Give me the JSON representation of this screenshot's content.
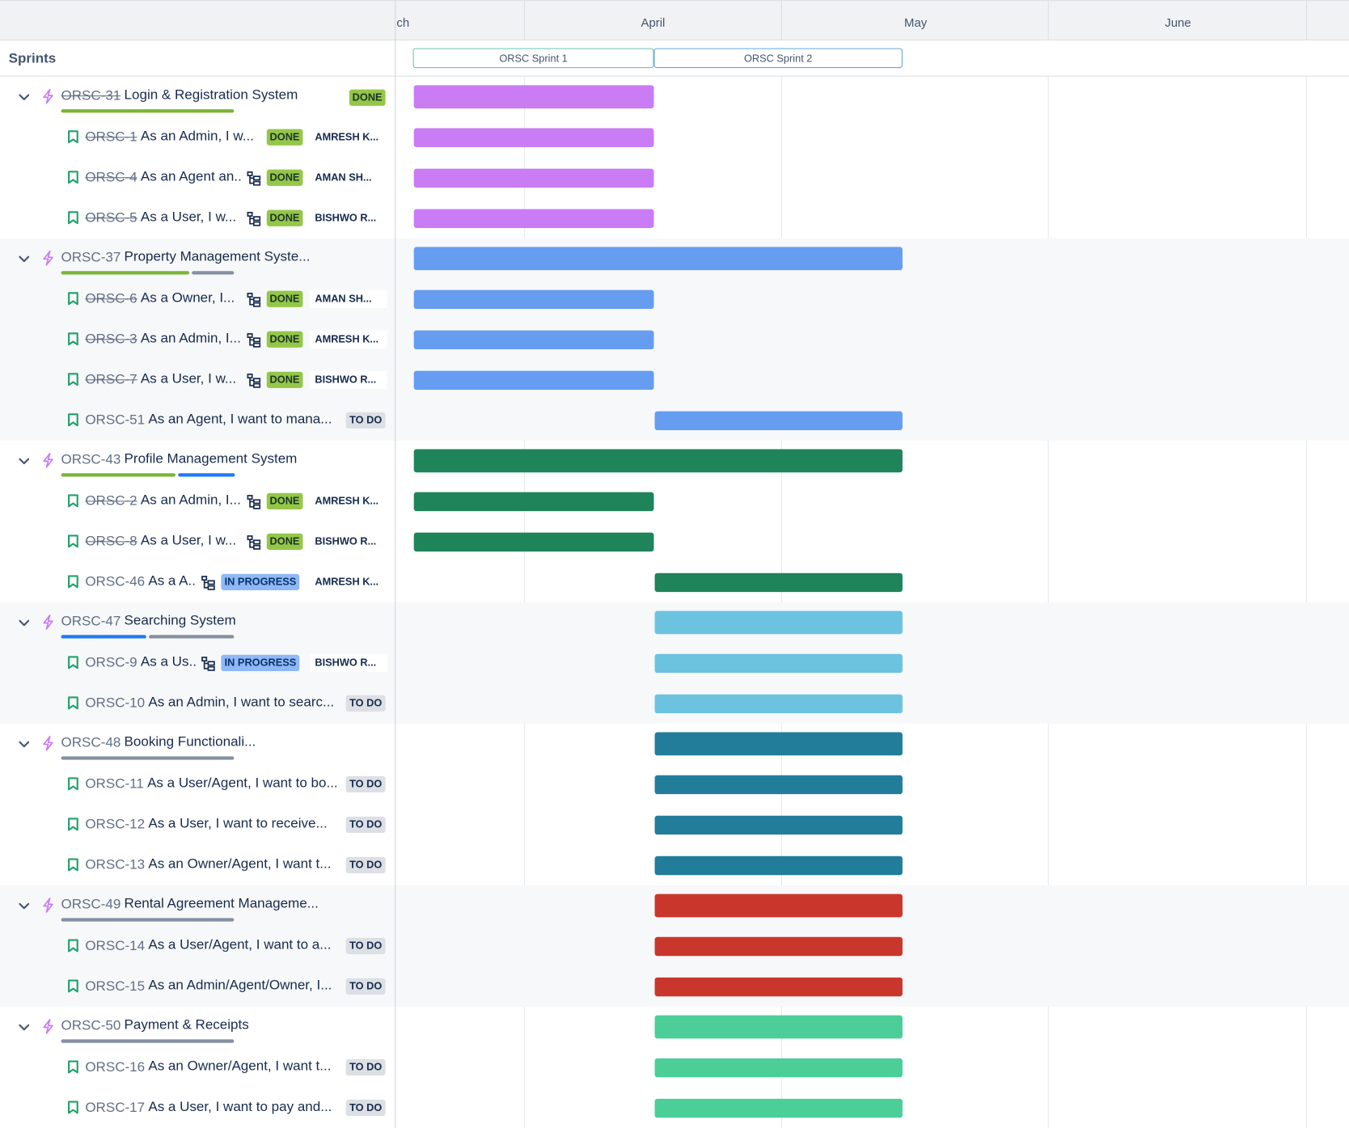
{
  "header": {
    "months": [
      "ch",
      "April",
      "May",
      "June"
    ],
    "sprints_label": "Sprints",
    "sprints": [
      "ORSC Sprint 1",
      "ORSC Sprint 2"
    ]
  },
  "colors": {
    "purple": "#c97cf4",
    "blue": "#669df1",
    "green": "#1f845a",
    "lightblue": "#6cc3e0",
    "teal": "#227d9b",
    "red": "#c9372c",
    "mint": "#4bce97",
    "done_green": "#94c748",
    "todo_grey": "#dcdfe4",
    "progress_blue": "#8fb8f6"
  },
  "epics": [
    {
      "key": "ORSC-31",
      "title": "Login & Registration System",
      "status": "DONE",
      "done": true,
      "color": "purple",
      "children": [
        {
          "key": "ORSC-1",
          "title": "As an Admin, I w...",
          "status": "DONE",
          "assignee": "AMRESH K...",
          "done": true,
          "hier": false
        },
        {
          "key": "ORSC-4",
          "title": "As an Agent an...",
          "status": "DONE",
          "assignee": "AMAN SH...",
          "done": true,
          "hier": true
        },
        {
          "key": "ORSC-5",
          "title": "As a User, I w...",
          "status": "DONE",
          "assignee": "BISHWO R...",
          "done": true,
          "hier": true
        }
      ]
    },
    {
      "key": "ORSC-37",
      "title": "Property Management Syste...",
      "status": "",
      "done": false,
      "color": "blue",
      "children": [
        {
          "key": "ORSC-6",
          "title": "As a Owner, I...",
          "status": "DONE",
          "assignee": "AMAN SH...",
          "done": true,
          "hier": true
        },
        {
          "key": "ORSC-3",
          "title": "As an Admin, I...",
          "status": "DONE",
          "assignee": "AMRESH K...",
          "done": true,
          "hier": true
        },
        {
          "key": "ORSC-7",
          "title": "As a User, I w...",
          "status": "DONE",
          "assignee": "BISHWO R...",
          "done": true,
          "hier": true
        },
        {
          "key": "ORSC-51",
          "title": "As an Agent, I want to mana...",
          "status": "TO DO",
          "assignee": "",
          "done": false,
          "hier": false
        }
      ]
    },
    {
      "key": "ORSC-43",
      "title": "Profile Management System",
      "status": "",
      "done": false,
      "color": "green",
      "children": [
        {
          "key": "ORSC-2",
          "title": "As an Admin, I...",
          "status": "DONE",
          "assignee": "AMRESH K...",
          "done": true,
          "hier": true
        },
        {
          "key": "ORSC-8",
          "title": "As a User, I w...",
          "status": "DONE",
          "assignee": "BISHWO R...",
          "done": true,
          "hier": true
        },
        {
          "key": "ORSC-46",
          "title": "As a A...",
          "status": "IN PROGRESS",
          "assignee": "AMRESH K...",
          "done": false,
          "hier": true
        }
      ]
    },
    {
      "key": "ORSC-47",
      "title": "Searching System",
      "status": "",
      "done": false,
      "color": "lightblue",
      "children": [
        {
          "key": "ORSC-9",
          "title": "As a Us...",
          "status": "IN PROGRESS",
          "assignee": "BISHWO R...",
          "done": false,
          "hier": true
        },
        {
          "key": "ORSC-10",
          "title": "As an Admin, I want to searc...",
          "status": "TO DO",
          "assignee": "",
          "done": false,
          "hier": false
        }
      ]
    },
    {
      "key": "ORSC-48",
      "title": "Booking Functionali...",
      "status": "",
      "done": false,
      "color": "teal",
      "children": [
        {
          "key": "ORSC-11",
          "title": "As a User/Agent, I want to bo...",
          "status": "TO DO",
          "assignee": "",
          "done": false,
          "hier": false
        },
        {
          "key": "ORSC-12",
          "title": "As a User, I want to receive...",
          "status": "TO DO",
          "assignee": "",
          "done": false,
          "hier": false
        },
        {
          "key": "ORSC-13",
          "title": "As an Owner/Agent, I want t...",
          "status": "TO DO",
          "assignee": "",
          "done": false,
          "hier": false
        }
      ]
    },
    {
      "key": "ORSC-49",
      "title": "Rental Agreement Manageme...",
      "status": "",
      "done": false,
      "color": "red",
      "children": [
        {
          "key": "ORSC-14",
          "title": "As a User/Agent, I want to a...",
          "status": "TO DO",
          "assignee": "",
          "done": false,
          "hier": false
        },
        {
          "key": "ORSC-15",
          "title": "As an Admin/Agent/Owner, I...",
          "status": "TO DO",
          "assignee": "",
          "done": false,
          "hier": false
        }
      ]
    },
    {
      "key": "ORSC-50",
      "title": "Payment & Receipts",
      "status": "",
      "done": false,
      "color": "mint",
      "children": [
        {
          "key": "ORSC-16",
          "title": "As an Owner/Agent, I want t...",
          "status": "TO DO",
          "assignee": "",
          "done": false,
          "hier": false
        },
        {
          "key": "ORSC-17",
          "title": "As a User, I want to pay and...",
          "status": "TO DO",
          "assignee": "",
          "done": false,
          "hier": false
        }
      ]
    }
  ]
}
